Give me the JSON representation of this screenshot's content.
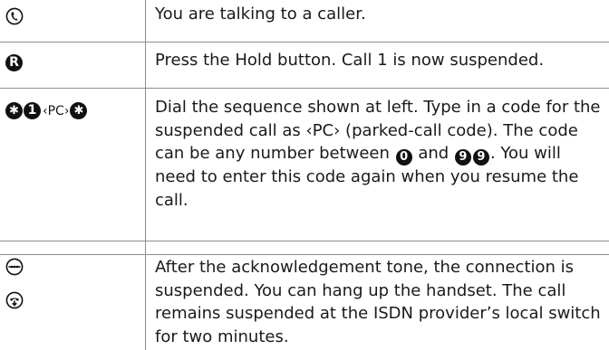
{
  "rows": [
    {
      "symbols": [
        {
          "icon": "handset-talking-icon"
        }
      ],
      "text": "You are talking to a caller."
    },
    {
      "symbols": [
        {
          "icon": "recall-r-key",
          "label": "R"
        }
      ],
      "text": "Press the Hold button. Call 1 is now suspended."
    },
    {
      "symbols": [
        {
          "icon": "star-key",
          "label": "✱"
        },
        {
          "icon": "digit-1-key",
          "label": "1"
        },
        {
          "icon": "parked-call-code",
          "label": "‹PC›"
        },
        {
          "icon": "star-key",
          "label": "✱"
        }
      ],
      "text_parts": {
        "line1": "Dial the sequence shown at left. Type in a code for the suspended call as ‹PC› (parked-call code). The code can be any number between ",
        "key_zero": "0",
        "and": " and ",
        "key_nine_a": "9",
        "key_nine_b": "9",
        "line2": ". You will need to enter this code again when you resume the call."
      }
    },
    {
      "symbols": [
        {
          "icon": "acknowledgement-tone-icon"
        },
        {
          "icon": "hang-up-handset-icon"
        }
      ],
      "text": "After the acknowledgement tone, the connection is suspended. You can hang up the handset. The call remains suspended at the ISDN provider’s local switch for two minutes."
    }
  ],
  "colors": {
    "text": "#1a1a1a",
    "rule": "#8c8c8c",
    "key_fill": "#111111"
  }
}
